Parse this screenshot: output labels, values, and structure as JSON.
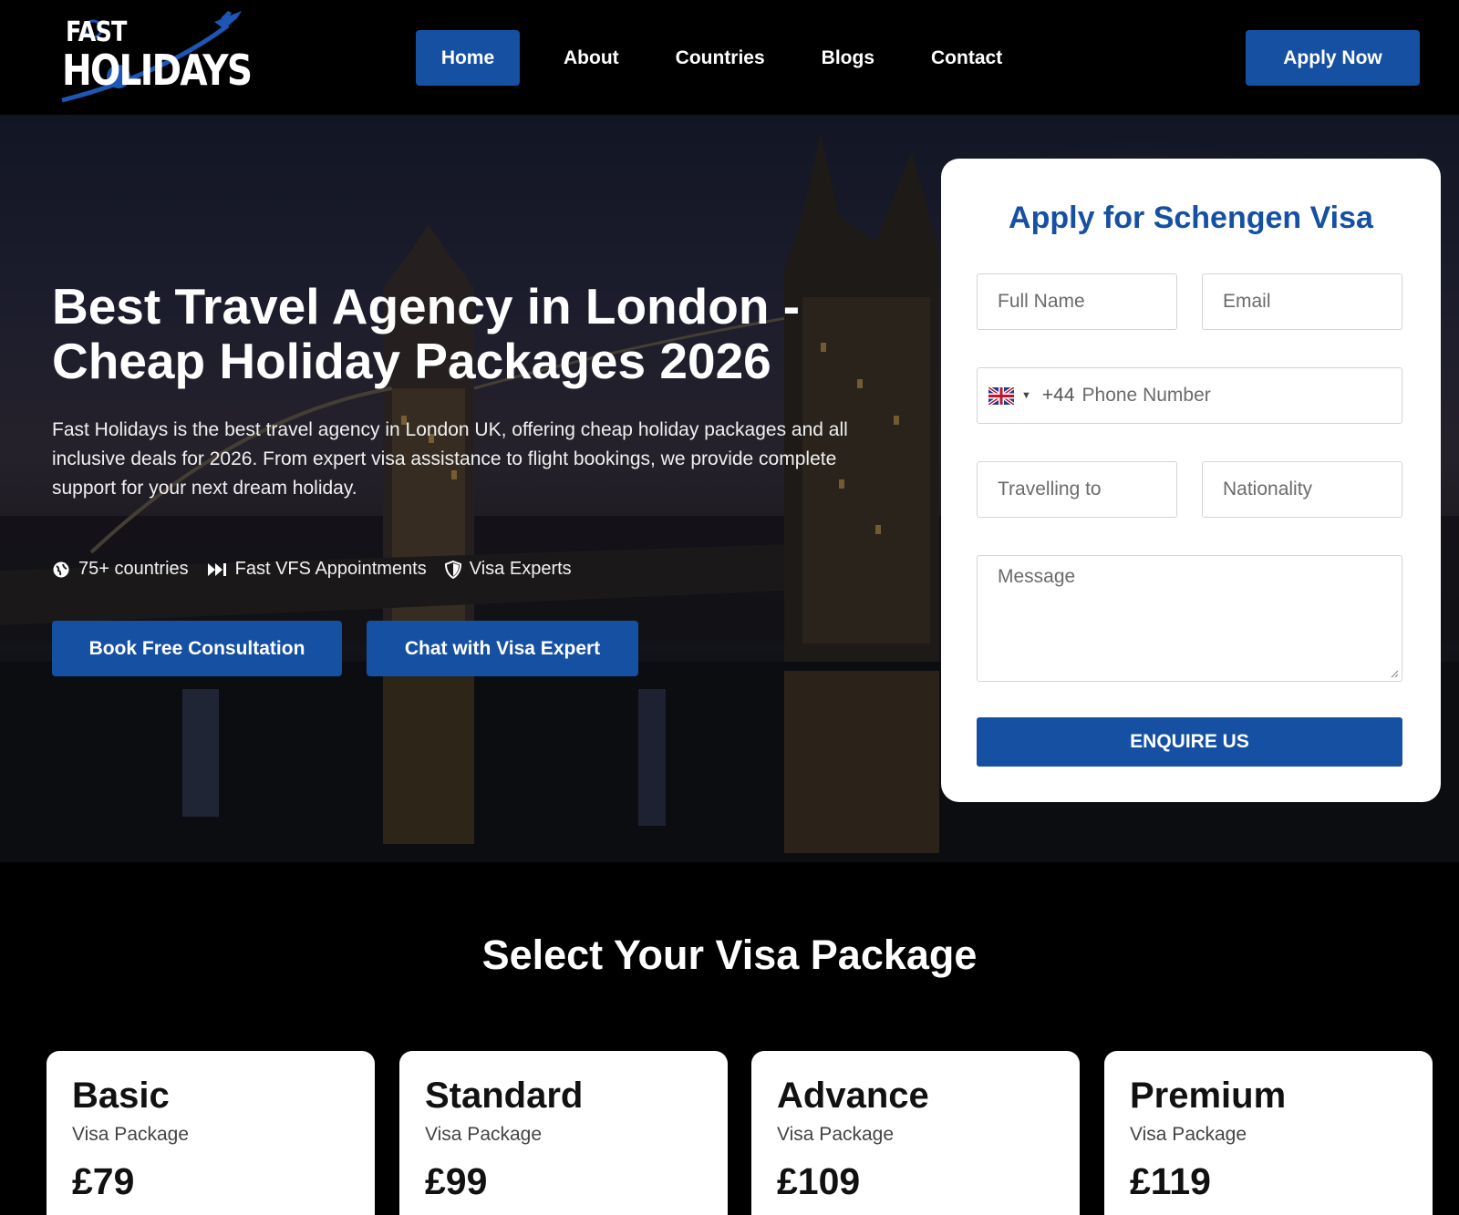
{
  "brand": {
    "line1": "FAST",
    "line2": "HOLIDAYS"
  },
  "nav": {
    "items": [
      {
        "label": "Home"
      },
      {
        "label": "About"
      },
      {
        "label": "Countries"
      },
      {
        "label": "Blogs"
      },
      {
        "label": "Contact"
      }
    ],
    "apply_label": "Apply Now"
  },
  "hero": {
    "title": "Best Travel Agency in London - Cheap Holiday Packages 2026",
    "description": "Fast Holidays is the best travel agency in London UK, offering cheap holiday packages and all inclusive deals for 2026. From expert visa assistance to flight bookings, we provide complete support for your next dream holiday.",
    "features": [
      {
        "icon": "globe-icon",
        "label": "75+ countries"
      },
      {
        "icon": "fast-forward-icon",
        "label": "Fast VFS Appointments"
      },
      {
        "icon": "shield-icon",
        "label": "Visa Experts"
      }
    ],
    "consult_label": "Book Free Consultation",
    "chat_label": "Chat with Visa Expert"
  },
  "form": {
    "title": "Apply for Schengen Visa",
    "name_placeholder": "Full Name",
    "email_placeholder": "Email",
    "country_flag": "uk-flag-icon",
    "dial_code": "+44",
    "phone_placeholder": "Phone Number",
    "travel_placeholder": "Travelling to",
    "nationality_placeholder": "Nationality",
    "message_placeholder": "Message",
    "submit_label": "ENQUIRE US"
  },
  "packages": {
    "title": "Select Your Visa Package",
    "items": [
      {
        "name": "Basic",
        "sub": "Visa Package",
        "price": "£79"
      },
      {
        "name": "Standard",
        "sub": "Visa Package",
        "price": "£99"
      },
      {
        "name": "Advance",
        "sub": "Visa Package",
        "price": "£109"
      },
      {
        "name": "Premium",
        "sub": "Visa Package",
        "price": "£119"
      }
    ]
  },
  "colors": {
    "accent": "#1650a2",
    "background": "#000000",
    "card": "#ffffff"
  }
}
